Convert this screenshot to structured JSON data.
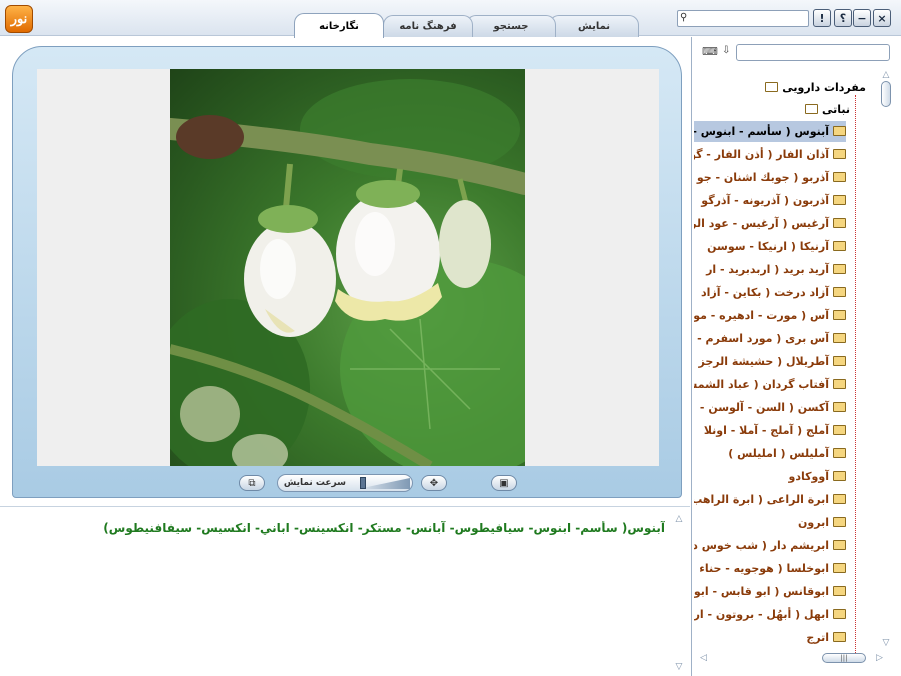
{
  "window": {
    "logo_text": "نور",
    "buttons": {
      "close": "×",
      "minimize": "−",
      "help": "؟",
      "info": "!"
    },
    "search_placeholder": ""
  },
  "tabs": [
    {
      "label": "نمایش",
      "active": false
    },
    {
      "label": "جستجو",
      "active": false
    },
    {
      "label": "فرهنگ نامه",
      "active": false
    },
    {
      "label": "نگارخانه",
      "active": true
    }
  ],
  "viewer": {
    "speed_label": "سرعت نمایش",
    "icons": [
      "copy-icon",
      "fit-screen-icon",
      "save-icon"
    ]
  },
  "description": "آبنوس( سأسم- ابنوس- سيافيطوس- آبانس- مستكر- انكسينس- اباني- انكسيس- سيفافنيطوس)",
  "tree": {
    "root": "مفردات دارویی",
    "category": "نباتی",
    "items": [
      {
        "label": "آبنوس ( سأسم - ابنوس -",
        "selected": true
      },
      {
        "label": "آذان الفار ( أذن الفار - گو",
        "selected": false
      },
      {
        "label": "آذربو ( جوبك اشنان - جو",
        "selected": false
      },
      {
        "label": "آذربون ( آذريونه - آذرگو",
        "selected": false
      },
      {
        "label": "آرغيس ( آرغيس - عود الر",
        "selected": false
      },
      {
        "label": "آرنيكا ( ارنيكا - سوسن",
        "selected": false
      },
      {
        "label": "آريد بريد ( اربدبريد - ار",
        "selected": false
      },
      {
        "label": "آزاد درخت ( بكاين - آزاد",
        "selected": false
      },
      {
        "label": "آس ( مورت - ادهيره - مو",
        "selected": false
      },
      {
        "label": "آس بری ( مورد اسفرم - ك",
        "selected": false
      },
      {
        "label": "آطريلال ( حشيشة الرجز",
        "selected": false
      },
      {
        "label": "آفتاب گردان ( عباد الشمس",
        "selected": false
      },
      {
        "label": "آكسن ( السن - آلوسن -",
        "selected": false
      },
      {
        "label": "آملج ( آملج - آملا - اونلا",
        "selected": false
      },
      {
        "label": "آمليلس ( امليلس )",
        "selected": false
      },
      {
        "label": "آووكادو",
        "selected": false
      },
      {
        "label": "ابرة الراعی ( ابرة الراهب",
        "selected": false
      },
      {
        "label": "ابرون",
        "selected": false
      },
      {
        "label": "ابريشم دار ( شب خوس دا",
        "selected": false
      },
      {
        "label": "ابوخلسا ( هوجويه - حناء",
        "selected": false
      },
      {
        "label": "ابوقانس ( ابو قابس - ابو",
        "selected": false
      },
      {
        "label": "ابهل ( أبهُل - بروتون - ار",
        "selected": false
      },
      {
        "label": "اترج",
        "selected": false
      }
    ]
  }
}
